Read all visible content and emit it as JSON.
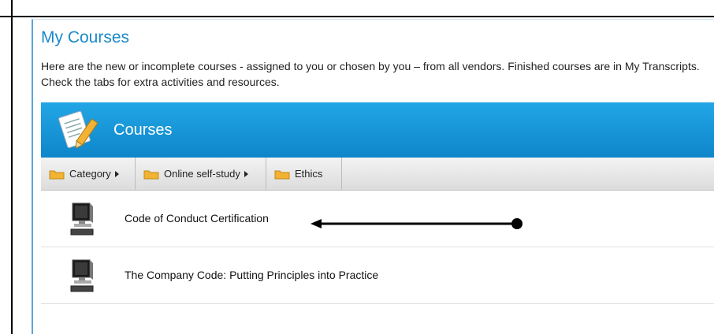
{
  "page": {
    "title": "My Courses",
    "description": "Here are the new or incomplete courses - assigned to you or chosen by you – from all vendors. Finished courses are in My Transcripts. Check the tabs for extra activities and resources."
  },
  "section": {
    "title": "Courses",
    "icon": "notepad-pencil-icon"
  },
  "breadcrumbs": [
    {
      "label": "Category"
    },
    {
      "label": "Online self-study"
    },
    {
      "label": "Ethics"
    }
  ],
  "courses": [
    {
      "title": "Code of Conduct Certification",
      "icon": "computer-icon"
    },
    {
      "title": "The Company Code: Putting Principles into Practice",
      "icon": "computer-icon"
    }
  ],
  "colors": {
    "accent": "#1b8ac9",
    "header_bar": "#0e86c9",
    "folder": "#f2b233"
  }
}
